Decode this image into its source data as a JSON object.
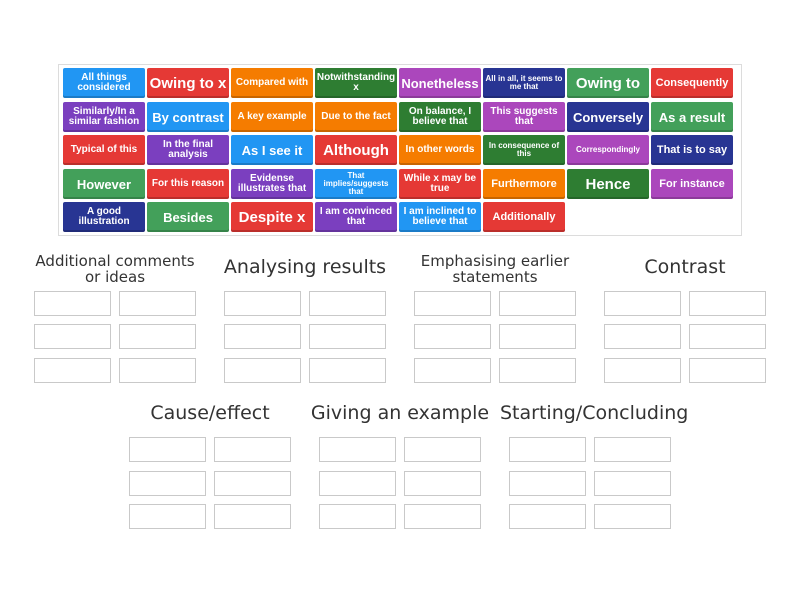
{
  "colors": {
    "blue": "#2196f3",
    "red": "#e53935",
    "orange": "#f57c00",
    "green": "#2e7d32",
    "violet": "#ab47bc",
    "navy": "#283593",
    "teal": "#43a05a",
    "purple": "#7b3fbf"
  },
  "tiles": [
    {
      "label": "All things considered",
      "color": "blue"
    },
    {
      "label": "Owing to x",
      "color": "red"
    },
    {
      "label": "Compared with",
      "color": "orange"
    },
    {
      "label": "Notwithstanding x",
      "color": "green"
    },
    {
      "label": "Nonetheless",
      "color": "violet"
    },
    {
      "label": "All in all, it seems to me that",
      "color": "navy"
    },
    {
      "label": "Owing to",
      "color": "teal"
    },
    {
      "label": "Consequently",
      "color": "red"
    },
    {
      "label": "Similarly/In a similar fashion",
      "color": "purple"
    },
    {
      "label": "By contrast",
      "color": "blue"
    },
    {
      "label": "A key example",
      "color": "orange"
    },
    {
      "label": "Due to the fact",
      "color": "orange"
    },
    {
      "label": "On balance, I believe that",
      "color": "green"
    },
    {
      "label": "This suggests that",
      "color": "violet"
    },
    {
      "label": "Conversely",
      "color": "navy"
    },
    {
      "label": "As a result",
      "color": "teal"
    },
    {
      "label": "Typical of this",
      "color": "red"
    },
    {
      "label": "In the final analysis",
      "color": "purple"
    },
    {
      "label": "As I see it",
      "color": "blue"
    },
    {
      "label": "Although",
      "color": "red"
    },
    {
      "label": "In other words",
      "color": "orange"
    },
    {
      "label": "In consequence of this",
      "color": "green"
    },
    {
      "label": "Correspondingly",
      "color": "violet"
    },
    {
      "label": "That is to say",
      "color": "navy"
    },
    {
      "label": "However",
      "color": "teal"
    },
    {
      "label": "For this reason",
      "color": "red"
    },
    {
      "label": "Evidense illustrates that",
      "color": "purple"
    },
    {
      "label": "That implies/suggests that",
      "color": "blue"
    },
    {
      "label": "While x may be true",
      "color": "red"
    },
    {
      "label": "Furthermore",
      "color": "orange"
    },
    {
      "label": "Hence",
      "color": "green"
    },
    {
      "label": "For instance",
      "color": "violet"
    },
    {
      "label": "A good illustration",
      "color": "navy"
    },
    {
      "label": "Besides",
      "color": "teal"
    },
    {
      "label": "Despite x",
      "color": "red"
    },
    {
      "label": "I am convinced that",
      "color": "purple"
    },
    {
      "label": "I am inclined to believe that",
      "color": "blue"
    },
    {
      "label": "Additionally",
      "color": "red"
    }
  ],
  "categories": [
    {
      "title": "Additional comments or ideas"
    },
    {
      "title": "Analysing results"
    },
    {
      "title": "Emphasising earlier statements"
    },
    {
      "title": "Contrast"
    },
    {
      "title": "Cause/effect"
    },
    {
      "title": "Giving an example"
    },
    {
      "title": "Starting/Concluding"
    }
  ]
}
